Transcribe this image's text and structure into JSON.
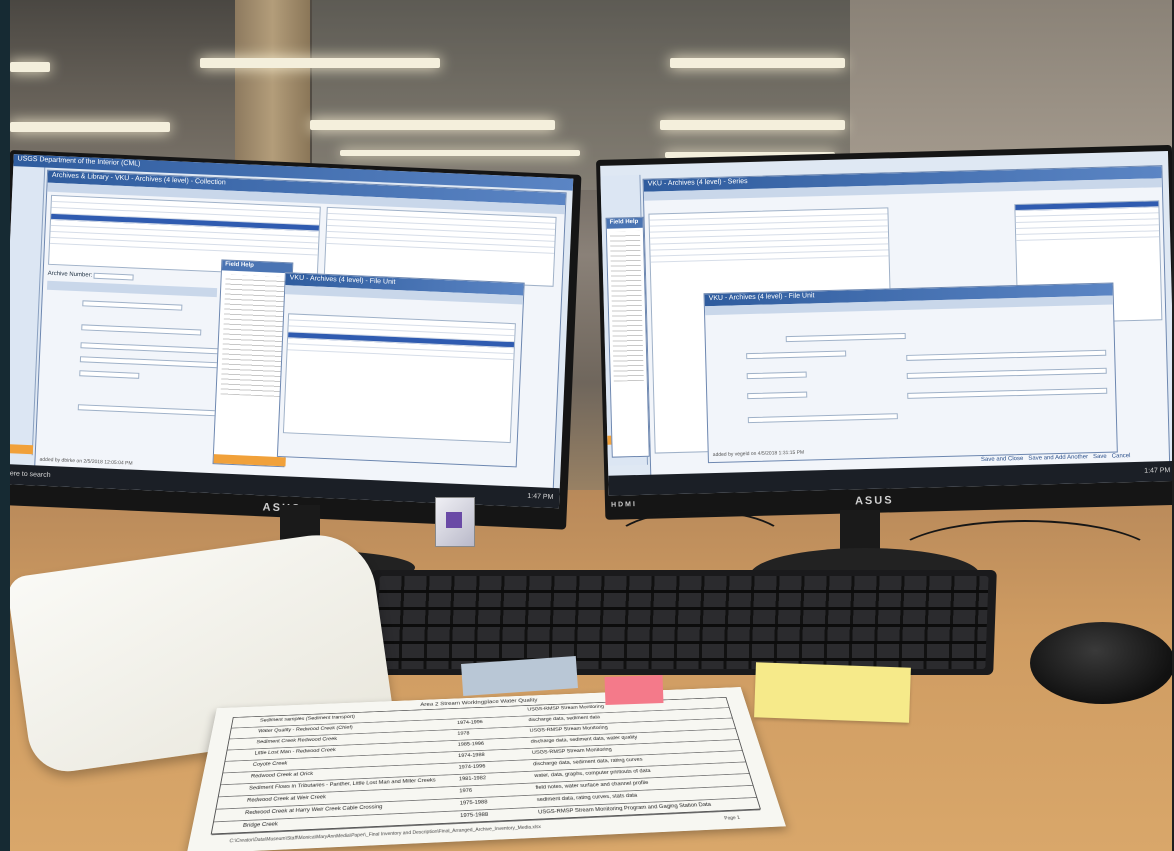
{
  "left_monitor": {
    "brand": "ASUS",
    "top_window_title": "USGS Department of the Interior (CML)",
    "main_window_title": "Archives & Library - VKU - Archives (4 level) - Collection",
    "archive_number_label": "Archive Number:",
    "field_help_title": "Field Help",
    "dialog_title": "VKU - Archives (4 level) - File Unit",
    "status_text": "added by dbirke on 2/5/2018 12:05:04 PM",
    "taskbar_search": "here to search",
    "clock": "1:47 PM"
  },
  "right_monitor": {
    "brand": "ASUS",
    "hdmi_label": "HDMI",
    "main_window_title": "VKU - Archives (4 level) - Series",
    "dialog_title": "VKU - Archives (4 level) - File Unit",
    "field_help_title": "Field Help",
    "status_text": "added by vegeld on 4/5/2018 1:31:15 PM",
    "footer_buttons": [
      "Save and Close",
      "Save and Add Another",
      "Save",
      "Cancel"
    ],
    "clock": "1:47 PM"
  },
  "document": {
    "title": "Area 2 Stream Workingplace Water Quality",
    "rows": [
      [
        "Sediment samples (Sediment transport)",
        "",
        "USGS-RMSP Stream Monitoring"
      ],
      [
        "Water Quality - Redwood Creek (Chief)",
        "1974-1996",
        "discharge data, sediment data"
      ],
      [
        "Sediment Creek Redwood Creek",
        "1978",
        "USGS-RMSP Stream Monitoring"
      ],
      [
        "Little Lost Man - Redwood Creek",
        "1985-1996",
        "discharge data, sediment data, water quality"
      ],
      [
        "Coyote Creek",
        "1974-1988",
        "USGS-RMSP Stream Monitoring"
      ],
      [
        "Redwood Creek at Orick",
        "1974-1996",
        "discharge data, sediment data, rating curves"
      ],
      [
        "Sediment Flows in Tributaries - Panther, Little Lost Man and Miller Creeks",
        "1981-1982",
        "water, data, graphs, computer printouts of data"
      ],
      [
        "Redwood Creek at Weir Creek",
        "1976",
        "field notes, water surface and channel profile"
      ],
      [
        "Redwood Creek at Harry Weir Creek Cable Crossing",
        "1975-1988",
        "sediment data, rating curves, stats data"
      ],
      [
        "Bridge Creek",
        "1975-1988",
        "USGS-RMSP Stream Monitoring Program and Gaging Station Data"
      ]
    ],
    "footer_path": "C:\\Creator\\Data\\Museum\\Staff\\Monica\\MaryAnnMedia\\Paper\\_Final Inventory and Description\\Final_Arranged_Archive_Inventory_Media.xlsx",
    "page_label": "Page 1"
  }
}
